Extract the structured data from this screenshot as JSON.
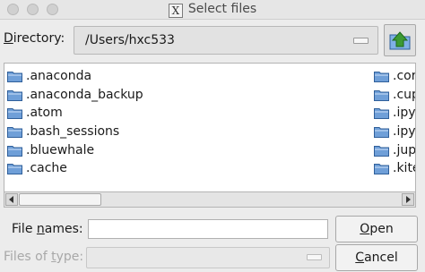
{
  "window": {
    "title": "Select files",
    "title_icon": "x11-icon"
  },
  "directory": {
    "label_mnemonic": "D",
    "label_rest": "irectory:",
    "path": "/Users/hxc533",
    "up_icon": "folder-up-icon"
  },
  "files": {
    "column1": [
      ".anaconda",
      ".anaconda_backup",
      ".atom",
      ".bash_sessions",
      ".bluewhale",
      ".cache"
    ],
    "column2": [
      ".cor",
      ".cup",
      ".ipy",
      ".ipy",
      ".jup",
      ".kite"
    ]
  },
  "file_names": {
    "label_pre": "File ",
    "label_mnemonic": "n",
    "label_post": "ames:",
    "value": ""
  },
  "files_of_type": {
    "label_pre": "Files of ",
    "label_mnemonic": "t",
    "label_post": "ype:",
    "value": ""
  },
  "buttons": {
    "open_mnemonic": "O",
    "open_rest": "pen",
    "cancel_mnemonic": "C",
    "cancel_rest": "ancel"
  },
  "colors": {
    "folder_fill": "#6f9fd8",
    "folder_stroke": "#2f5f9a",
    "up_arrow": "#3c9a34"
  }
}
